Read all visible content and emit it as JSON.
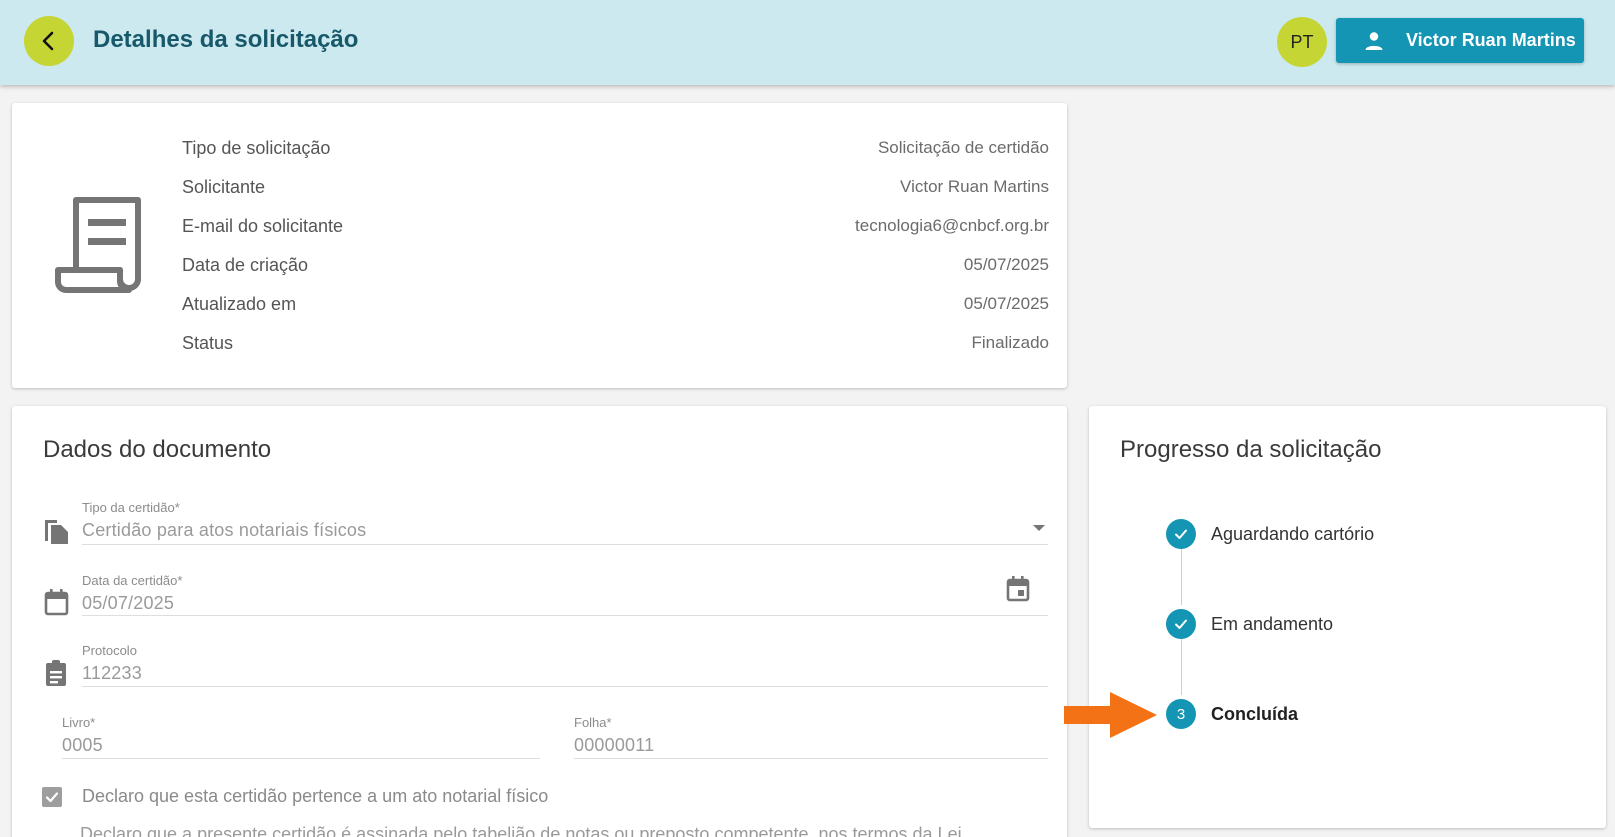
{
  "header": {
    "title": "Detalhes da solicitação",
    "lang_label": "PT",
    "user_name": "Victor Ruan Martins"
  },
  "summary": {
    "rows": [
      {
        "label": "Tipo de solicitação",
        "value": "Solicitação de certidão"
      },
      {
        "label": "Solicitante",
        "value": "Victor Ruan Martins"
      },
      {
        "label": "E-mail do solicitante",
        "value": "tecnologia6@cnbcf.org.br"
      },
      {
        "label": "Data de criação",
        "value": "05/07/2025"
      },
      {
        "label": "Atualizado em",
        "value": "05/07/2025"
      },
      {
        "label": "Status",
        "value": "Finalizado"
      }
    ]
  },
  "document": {
    "title": "Dados do documento",
    "tipo_label": "Tipo da certidão*",
    "tipo_value": "Certidão para atos notariais físicos",
    "data_label": "Data da certidão*",
    "data_value": "05/07/2025",
    "protocolo_label": "Protocolo",
    "protocolo_value": "112233",
    "livro_label": "Livro*",
    "livro_value": "0005",
    "folha_label": "Folha*",
    "folha_value": "00000011",
    "checkbox_label": "Declaro que esta certidão pertence a um ato notarial físico",
    "checkbox_checked": true,
    "declaration_text": "Declaro que a presente certidão é assinada pelo tabelião de notas ou preposto competente, nos termos da Lei"
  },
  "progress": {
    "title": "Progresso da solicitação",
    "steps": [
      {
        "label": "Aguardando cartório",
        "state": "done"
      },
      {
        "label": "Em andamento",
        "state": "done"
      },
      {
        "label": "Concluída",
        "state": "current",
        "number": "3"
      }
    ]
  },
  "colors": {
    "header_bg": "#cce9ef",
    "accent_yellow": "#c5d534",
    "primary_teal": "#1595b4",
    "title_teal": "#17596b",
    "arrow_orange": "#f47216"
  },
  "icons": {
    "back": "chevron-left-icon",
    "user": "person-icon",
    "document": "receipt-icon",
    "tipo": "file-copy-icon",
    "data": "calendar-icon",
    "date_picker": "event-icon",
    "protocolo": "clipboard-icon",
    "dropdown": "caret-down-icon",
    "step_done": "check-icon",
    "pointer": "arrow-right-icon"
  }
}
